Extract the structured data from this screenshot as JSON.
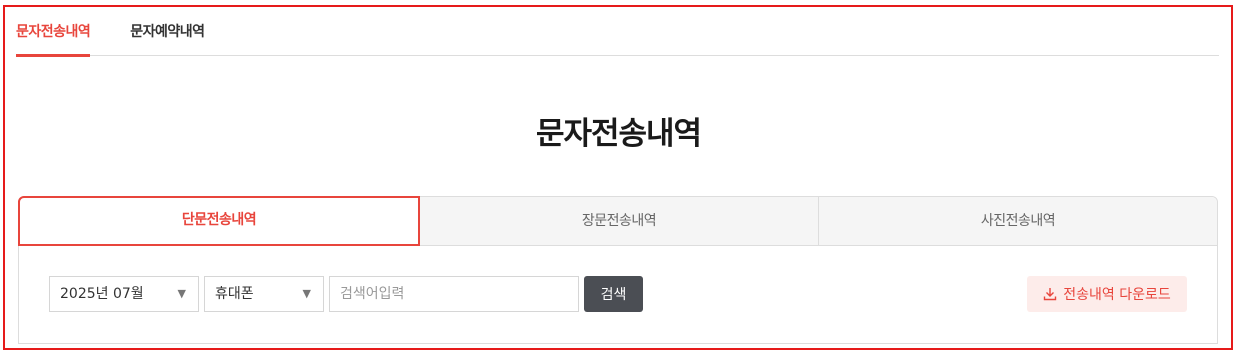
{
  "top_tabs": [
    {
      "label": "문자전송내역",
      "active": true
    },
    {
      "label": "문자예약내역",
      "active": false
    }
  ],
  "page_title": "문자전송내역",
  "sub_tabs": [
    {
      "label": "단문전송내역",
      "active": true
    },
    {
      "label": "장문전송내역",
      "active": false
    },
    {
      "label": "사진전송내역",
      "active": false
    }
  ],
  "filters": {
    "month_value": "2025년 07월",
    "type_value": "휴대폰",
    "search_placeholder": "검색어입력",
    "search_value": "",
    "search_label": "검색"
  },
  "download_label": "전송내역 다운로드",
  "icons": {
    "dropdown": "triangle-down-icon",
    "download": "download-icon"
  },
  "colors": {
    "accent": "#e8453c",
    "frame": "#e61a1a",
    "search_button": "#4b4e54",
    "download_bg": "#fdecea"
  }
}
